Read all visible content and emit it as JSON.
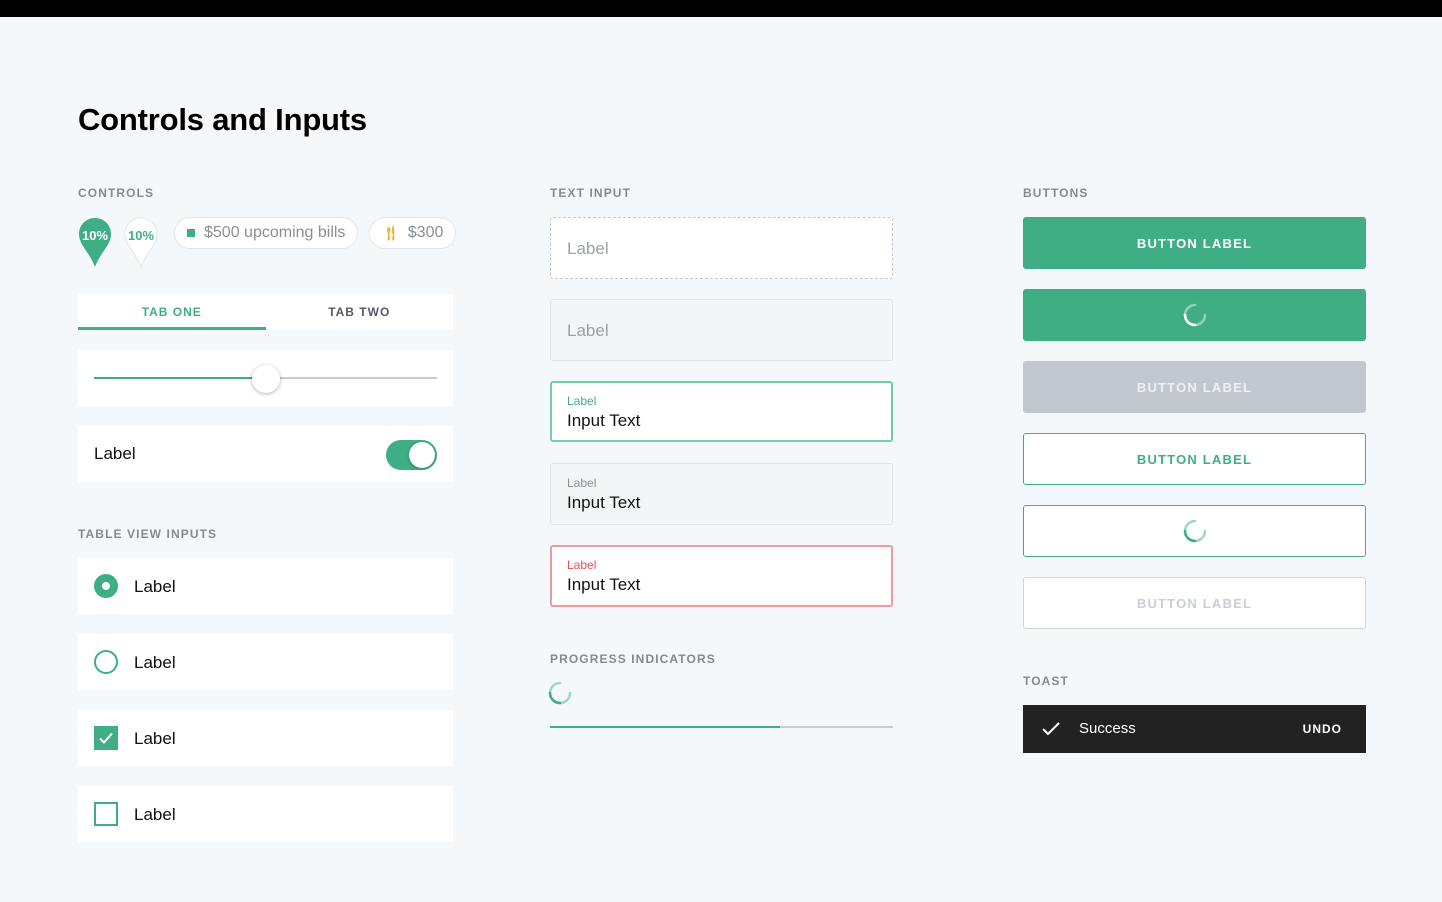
{
  "page": {
    "title": "Controls and Inputs"
  },
  "sections": {
    "controls": "CONTROLS",
    "table_view_inputs": "TABLE VIEW INPUTS",
    "text_input": "TEXT INPUT",
    "progress_indicators": "PROGRESS INDICATORS",
    "buttons": "BUTTONS",
    "toast": "TOAST"
  },
  "pins": [
    {
      "label": "10%",
      "style": "filled"
    },
    {
      "label": "10%",
      "style": "outline"
    }
  ],
  "pills": [
    {
      "text": "$500 upcoming bills",
      "icon": "square-icon"
    },
    {
      "text": "$300",
      "icon": "fork-knife-icon"
    }
  ],
  "tabs": [
    {
      "label": "TAB ONE",
      "active": true
    },
    {
      "label": "TAB TWO",
      "active": false
    }
  ],
  "slider": {
    "value": 0.5
  },
  "toggle": {
    "label": "Label",
    "on": true
  },
  "table_view": [
    {
      "type": "radio",
      "checked": true,
      "label": "Label"
    },
    {
      "type": "radio",
      "checked": false,
      "label": "Label"
    },
    {
      "type": "checkbox",
      "checked": true,
      "label": "Label"
    },
    {
      "type": "checkbox",
      "checked": false,
      "label": "Label"
    }
  ],
  "text_inputs": [
    {
      "state": "empty-dashed",
      "placeholder": "Label"
    },
    {
      "state": "empty-filled",
      "placeholder": "Label"
    },
    {
      "state": "focused",
      "label": "Label",
      "value": "Input Text"
    },
    {
      "state": "filled",
      "label": "Label",
      "value": "Input Text"
    },
    {
      "state": "error",
      "label": "Label",
      "value": "Input Text"
    }
  ],
  "progress": {
    "value": 0.67
  },
  "buttons": [
    {
      "variant": "solid",
      "label": "BUTTON LABEL"
    },
    {
      "variant": "solid-loading",
      "label": ""
    },
    {
      "variant": "solid-disabled",
      "label": "BUTTON LABEL"
    },
    {
      "variant": "outline",
      "label": "BUTTON LABEL"
    },
    {
      "variant": "outline-loading",
      "label": ""
    },
    {
      "variant": "outline-disabled",
      "label": "BUTTON LABEL"
    }
  ],
  "toast": {
    "message": "Success",
    "action": "UNDO",
    "icon": "checkmark-icon"
  },
  "colors": {
    "accent": "#3fae84",
    "focus_border": "#6fd0a8",
    "error": "#e8505b",
    "background": "#f5f8fa",
    "toast_bg": "#222222"
  }
}
